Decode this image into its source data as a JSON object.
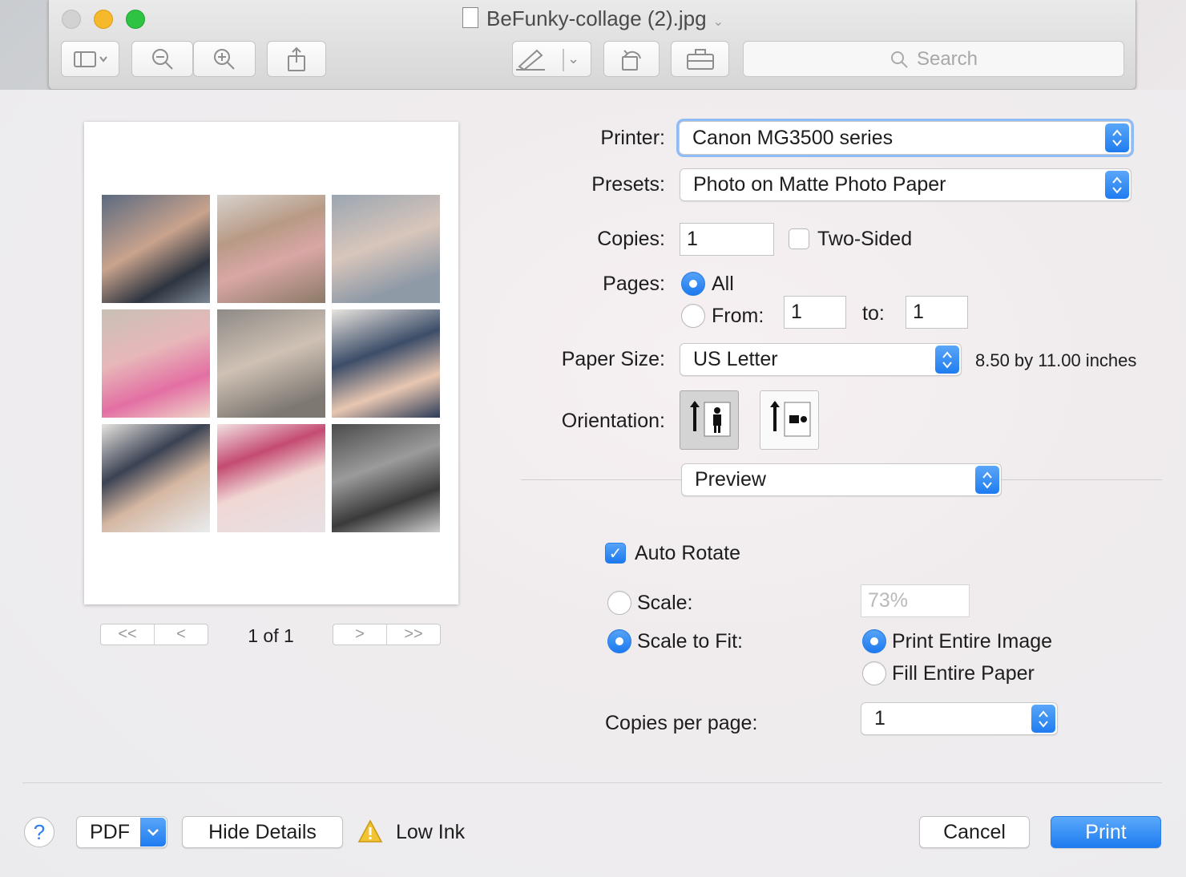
{
  "window": {
    "title": "BeFunky-collage (2).jpg",
    "search_placeholder": "Search"
  },
  "print": {
    "printer_label": "Printer:",
    "printer_value": "Canon MG3500 series",
    "presets_label": "Presets:",
    "presets_value": "Photo on Matte Photo Paper",
    "copies_label": "Copies:",
    "copies_value": "1",
    "two_sided_label": "Two-Sided",
    "pages_label": "Pages:",
    "pages_all_label": "All",
    "pages_from_label": "From:",
    "pages_from_value": "1",
    "pages_to_label": "to:",
    "pages_to_value": "1",
    "paper_size_label": "Paper Size:",
    "paper_size_value": "US Letter",
    "paper_size_dims": "8.50 by 11.00 inches",
    "orientation_label": "Orientation:",
    "section_value": "Preview",
    "auto_rotate_label": "Auto Rotate",
    "scale_label": "Scale:",
    "scale_value": "73%",
    "scale_to_fit_label": "Scale to Fit:",
    "print_entire_image_label": "Print Entire Image",
    "fill_entire_paper_label": "Fill Entire Paper",
    "copies_per_page_label": "Copies per page:",
    "copies_per_page_value": "1"
  },
  "preview": {
    "page_indicator": "1 of 1"
  },
  "footer": {
    "help_label": "?",
    "pdf_label": "PDF",
    "hide_details_label": "Hide Details",
    "low_ink_label": "Low Ink",
    "cancel_label": "Cancel",
    "print_label": "Print"
  },
  "colors": {
    "accent": "#1f7cf0",
    "print_button": "#2b86f3"
  }
}
